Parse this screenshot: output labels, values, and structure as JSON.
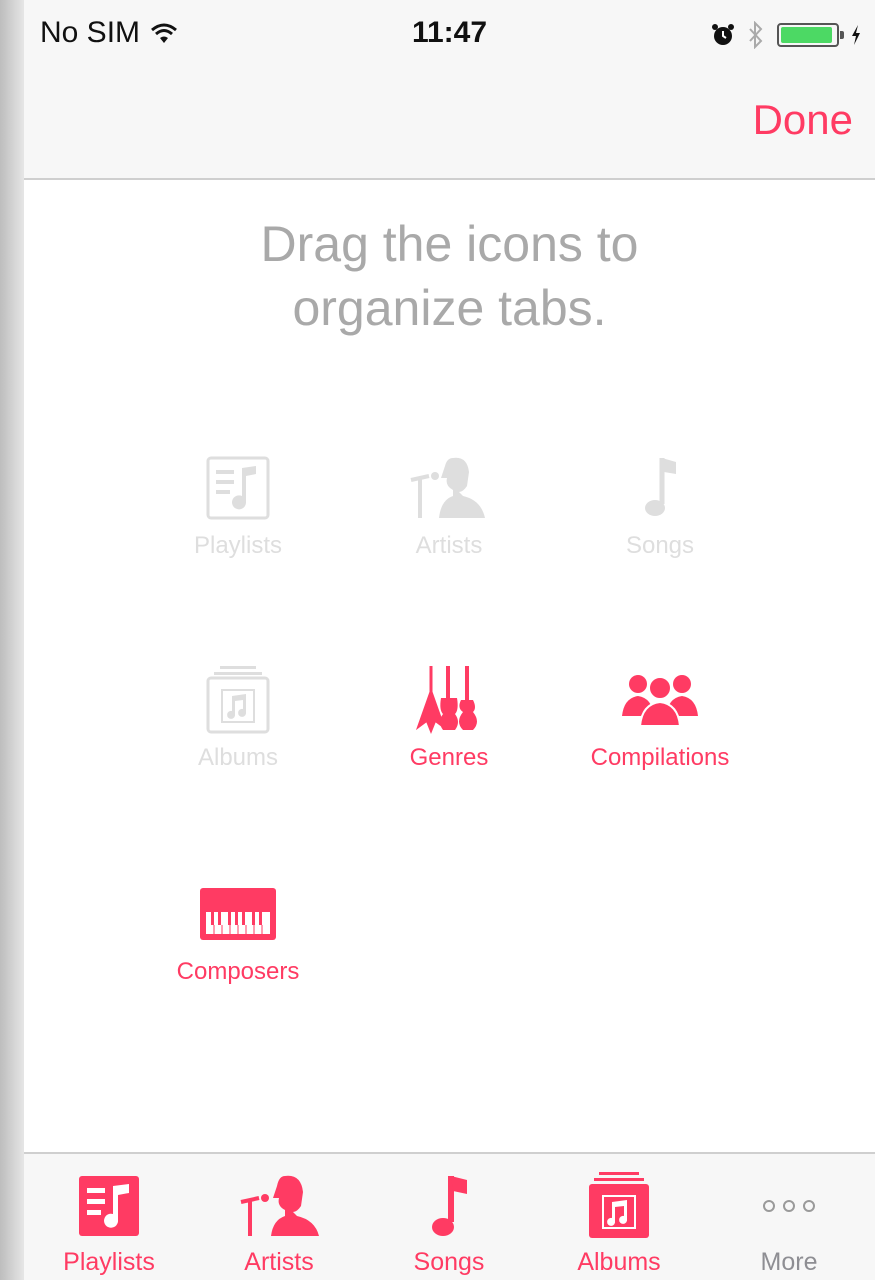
{
  "status_bar": {
    "carrier": "No SIM",
    "time": "11:47",
    "battery_level": 0.95,
    "icons": [
      "wifi-icon",
      "alarm-icon",
      "bluetooth-icon",
      "battery-icon",
      "charging-icon"
    ]
  },
  "nav": {
    "done_label": "Done"
  },
  "instruction": {
    "line1": "Drag the icons to",
    "line2": "organize tabs."
  },
  "grid": [
    {
      "label": "Playlists",
      "icon": "playlists-icon",
      "state": "in-tab-bar"
    },
    {
      "label": "Artists",
      "icon": "artists-icon",
      "state": "in-tab-bar"
    },
    {
      "label": "Songs",
      "icon": "songs-icon",
      "state": "in-tab-bar"
    },
    {
      "label": "Albums",
      "icon": "albums-icon",
      "state": "in-tab-bar"
    },
    {
      "label": "Genres",
      "icon": "genres-icon",
      "state": "available"
    },
    {
      "label": "Compilations",
      "icon": "compilations-icon",
      "state": "available"
    },
    {
      "label": "Composers",
      "icon": "composers-icon",
      "state": "available"
    }
  ],
  "tab_bar": [
    {
      "label": "Playlists",
      "icon": "playlists-icon"
    },
    {
      "label": "Artists",
      "icon": "artists-icon"
    },
    {
      "label": "Songs",
      "icon": "songs-icon"
    },
    {
      "label": "Albums",
      "icon": "albums-icon"
    },
    {
      "label": "More",
      "icon": "more-icon"
    }
  ],
  "colors": {
    "accent": "#ff3b63",
    "dimmed": "#dedede",
    "instruction_text": "#a9a9a9",
    "battery_green": "#4cd964"
  }
}
